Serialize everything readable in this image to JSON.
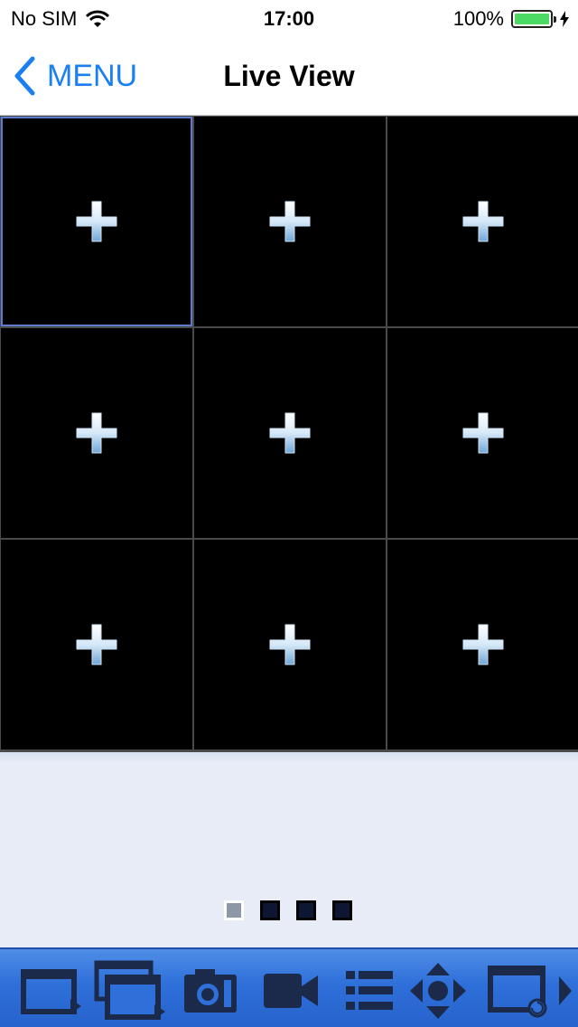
{
  "status_bar": {
    "carrier": "No SIM",
    "time": "17:00",
    "battery_percent": "100%",
    "battery_level": 1.0,
    "battery_color": "#4cd964"
  },
  "nav": {
    "back_label": "MENU",
    "title": "Live View",
    "accent_color": "#1a7ff0"
  },
  "grid": {
    "rows": 3,
    "columns": 3,
    "selected_cell": 0,
    "cell_icon": "plus-icon"
  },
  "pager": {
    "page_count": 4,
    "current_page": 1
  },
  "toolbar": {
    "items": [
      {
        "name": "single-view-play-icon"
      },
      {
        "name": "multi-view-play-icon"
      },
      {
        "name": "camera-snapshot-icon"
      },
      {
        "name": "video-record-icon"
      },
      {
        "name": "list-icon"
      },
      {
        "name": "ptz-direction-icon"
      },
      {
        "name": "screen-refresh-icon"
      },
      {
        "name": "next-arrow-icon"
      }
    ],
    "bg_color": "#2e6fd9",
    "icon_color": "#1b2a4a"
  }
}
